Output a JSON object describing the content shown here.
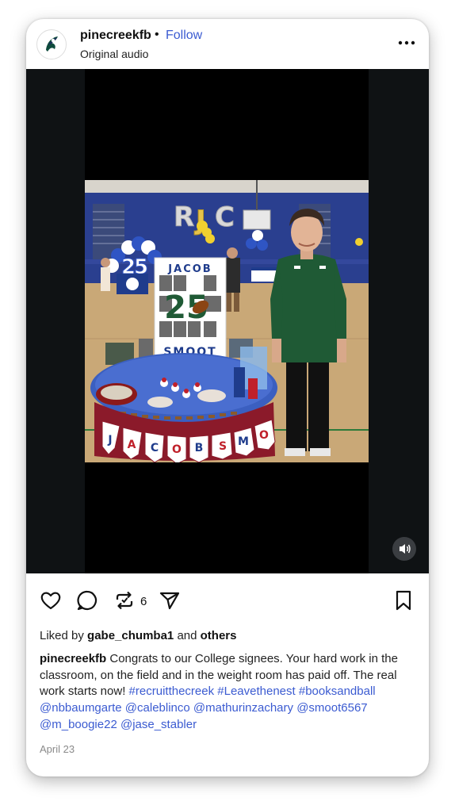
{
  "post": {
    "username": "pinecreekfb",
    "separator": "•",
    "follow_label": "Follow",
    "subtitle": "Original audio",
    "more_icon": "ellipsis-icon",
    "repost_count": "6",
    "liked_prefix": "Liked by",
    "liked_user": "gabe_chumba1",
    "liked_and": "and",
    "liked_others": "others",
    "caption_user": "pinecreekfb",
    "caption_text": "Congrats to our College signees. Your hard work in the classroom, on the field and in the weight room has paid off. The real work starts now!",
    "hashtags": [
      "#recruitthecreek",
      "#Leavethenest",
      "#booksandball"
    ],
    "mentions": [
      "@nbbaumgarte",
      "@caleblinco",
      "@mathurinzachary",
      "@smoot6567",
      "@m_boogie22",
      "@jase_stabler"
    ],
    "date": "April 23"
  },
  "photo": {
    "balloons": "RJC",
    "poster_name_top": "JACOB",
    "poster_number": "25",
    "poster_name_bottom": "SMOOT",
    "banner_letters": [
      "J",
      "A",
      "C",
      "O",
      "B",
      "S",
      "M",
      "O"
    ]
  },
  "colors": {
    "link": "#3b5bd1",
    "media_bg": "#0f1214",
    "shirt": "#1f5a35",
    "gym_wall": "#2a3f8f"
  }
}
